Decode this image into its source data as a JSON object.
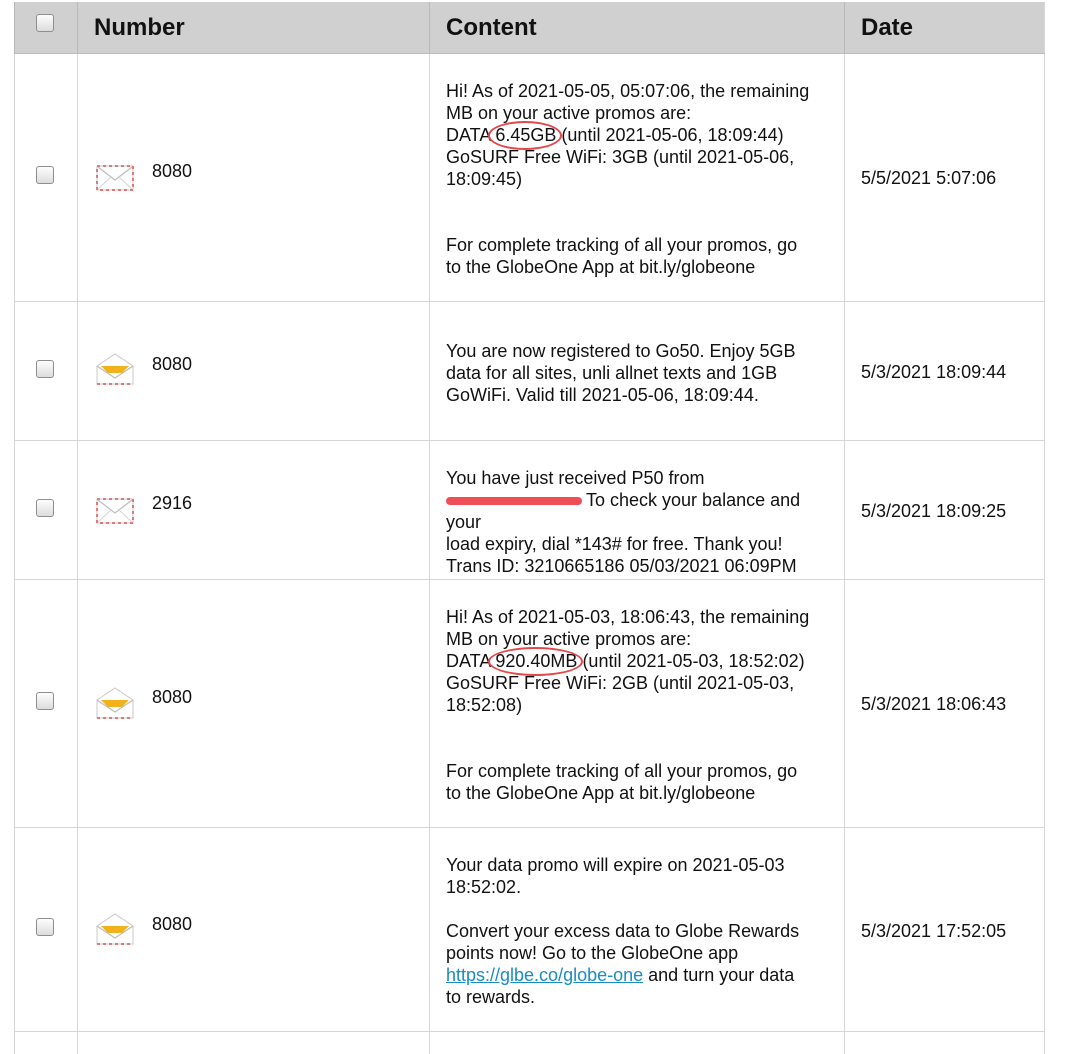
{
  "header": {
    "select_all": false,
    "col_number": "Number",
    "col_content": "Content",
    "col_date": "Date"
  },
  "messages": [
    {
      "number": "8080",
      "icon": "envelope-closed-icon",
      "date": "5/5/2021 5:07:06",
      "lines": [
        "Hi! As of 2021-05-05, 05:07:06, the remaining",
        "MB on your active promos are:",
        "DATA",
        "6.45GB",
        "(until 2021-05-06, 18:09:44)",
        "GoSURF Free WiFi: 3GB (until 2021-05-06,",
        "18:09:45)",
        "For complete tracking of all your promos, go",
        "to the GlobeOne App at bit.ly/globeone"
      ]
    },
    {
      "number": "8080",
      "icon": "envelope-open-icon",
      "date": "5/3/2021 18:09:44",
      "lines": [
        "You are now registered to Go50. Enjoy 5GB",
        "data for all sites, unli allnet texts and 1GB",
        "GoWiFi. Valid till 2021-05-06, 18:09:44."
      ]
    },
    {
      "number": "2916",
      "icon": "envelope-closed-icon",
      "date": "5/3/2021 18:09:25",
      "lines": [
        "You have just received P50 from",
        "To check your balance and your",
        "load expiry, dial *143# for free. Thank you!",
        "Trans ID: 3210665186 05/03/2021 06:09PM"
      ]
    },
    {
      "number": "8080",
      "icon": "envelope-open-icon",
      "date": "5/3/2021 18:06:43",
      "lines": [
        "Hi! As of 2021-05-03, 18:06:43, the remaining",
        "MB on your active promos are:",
        "DATA",
        "920.40MB",
        "(until 2021-05-03, 18:52:02)",
        "GoSURF Free WiFi: 2GB (until 2021-05-03,",
        "18:52:08)",
        "For complete tracking of all your promos, go",
        "to the GlobeOne App at bit.ly/globeone"
      ]
    },
    {
      "number": "8080",
      "icon": "envelope-open-icon",
      "date": "5/3/2021 17:52:05",
      "lines": [
        "Your data promo will expire on 2021-05-03",
        "18:52:02.",
        "Convert your excess data to Globe Rewards",
        "points now! Go to the GlobeOne app",
        "https://glbe.co/globe-one",
        "and turn your data",
        "to rewards."
      ]
    }
  ],
  "colors": {
    "header_bg": "#d0d0d0",
    "border": "#d6d6d6",
    "highlight": "#e5474b",
    "link": "#1a8cc4"
  }
}
